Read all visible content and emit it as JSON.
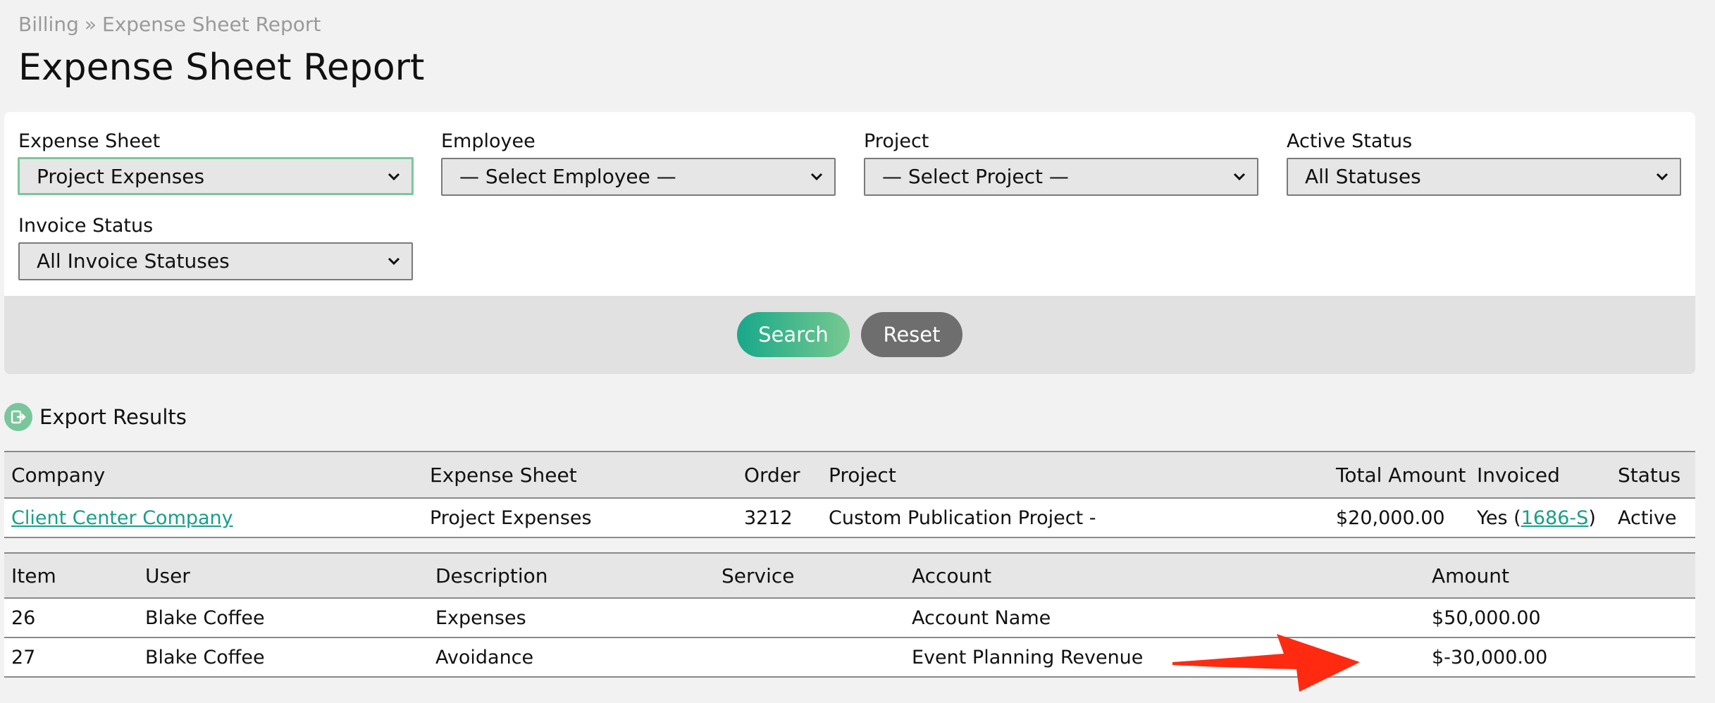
{
  "breadcrumb": {
    "root": "Billing",
    "separator": "»",
    "current": "Expense Sheet Report"
  },
  "page_title": "Expense Sheet Report",
  "filters": {
    "expense_sheet": {
      "label": "Expense Sheet",
      "value": "Project Expenses"
    },
    "employee": {
      "label": "Employee",
      "value": "— Select Employee —"
    },
    "project": {
      "label": "Project",
      "value": "— Select Project —"
    },
    "active_status": {
      "label": "Active Status",
      "value": "All Statuses"
    },
    "invoice_status": {
      "label": "Invoice Status",
      "value": "All Invoice Statuses"
    }
  },
  "buttons": {
    "search": "Search",
    "reset": "Reset"
  },
  "export": {
    "label": "Export Results",
    "icon": "export-icon"
  },
  "summary_table": {
    "headers": {
      "company": "Company",
      "expense_sheet": "Expense Sheet",
      "order": "Order",
      "project": "Project",
      "total_amount": "Total Amount",
      "invoiced": "Invoiced",
      "status": "Status"
    },
    "row": {
      "company": "Client Center Company",
      "expense_sheet": "Project Expenses",
      "order": "3212",
      "project": "Custom Publication Project -",
      "total_amount": "$20,000.00",
      "invoiced_prefix": "Yes (",
      "invoice_link": "1686-S",
      "invoiced_suffix": ")",
      "status": "Active"
    }
  },
  "items_table": {
    "headers": {
      "item": "Item",
      "user": "User",
      "description": "Description",
      "service": "Service",
      "account": "Account",
      "amount": "Amount"
    },
    "rows": [
      {
        "item": "26",
        "user": "Blake Coffee",
        "description": "Expenses",
        "service": "",
        "account": "Account Name",
        "amount": "$50,000.00"
      },
      {
        "item": "27",
        "user": "Blake Coffee",
        "description": "Avoidance",
        "service": "",
        "account": "Event Planning Revenue",
        "amount": "$-30,000.00"
      }
    ]
  },
  "colors": {
    "accent": "#17a086",
    "annotation_arrow": "#ff2a10"
  }
}
